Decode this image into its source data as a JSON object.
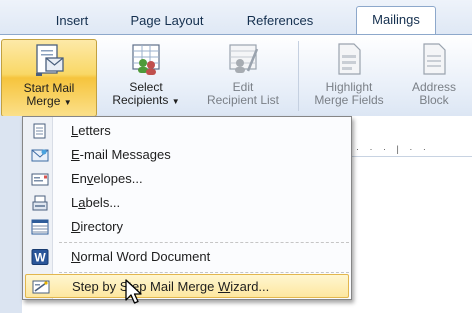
{
  "tabs": [
    {
      "label": "Insert",
      "active": false
    },
    {
      "label": "Page Layout",
      "active": false
    },
    {
      "label": "References",
      "active": false
    },
    {
      "label": "Mailings",
      "active": true
    }
  ],
  "ribbon": {
    "start_mail_merge": {
      "line1": "Start Mail",
      "line2": "Merge",
      "icon": "start-mail-merge-icon",
      "state": "pressed"
    },
    "select_recipients": {
      "line1": "Select",
      "line2": "Recipients",
      "icon": "select-recipients-icon"
    },
    "edit_recipient_list": {
      "line1": "Edit",
      "line2": "Recipient List",
      "icon": "edit-recipient-list-icon",
      "disabled": true
    },
    "highlight_merge_fields": {
      "line1": "Highlight",
      "line2": "Merge Fields",
      "icon": "highlight-merge-fields-icon",
      "disabled": true
    },
    "address_block": {
      "line1": "Address",
      "line2": "Block",
      "icon": "address-block-icon",
      "disabled": true
    }
  },
  "menu": {
    "items": [
      {
        "pre": "",
        "key": "L",
        "post": "etters",
        "icon": "letters-icon"
      },
      {
        "pre": "",
        "key": "E",
        "post": "-mail Messages",
        "icon": "email-icon"
      },
      {
        "pre": "En",
        "key": "v",
        "post": "elopes...",
        "icon": "envelope-icon"
      },
      {
        "pre": "L",
        "key": "a",
        "post": "bels...",
        "icon": "labels-icon"
      },
      {
        "pre": "",
        "key": "D",
        "post": "irectory",
        "icon": "directory-icon"
      },
      {
        "pre": "",
        "key": "N",
        "post": "ormal Word Document",
        "icon": "word-icon"
      },
      {
        "pre": "Step by Step Mail Merge ",
        "key": "W",
        "post": "izard...",
        "icon": "wizard-icon",
        "highlighted": true
      }
    ]
  },
  "colors": {
    "pressed_button": "#f9d866",
    "highlight_item": "#fde7a0",
    "tab_text": "#15304f",
    "word_icon_blue": "#2a5699"
  }
}
